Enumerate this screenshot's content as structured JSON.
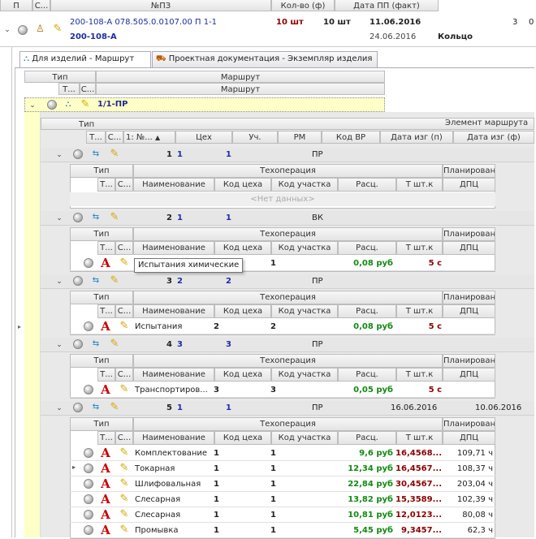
{
  "top": {
    "header": {
      "col1": "П",
      "col2": "С...",
      "col3": "№ПЗ",
      "col4": "Кол-во (ф)",
      "col5": "Дата ПП (факт)"
    },
    "row": {
      "pz": "200-108-А 078.505.0.0107.00 П 1-1",
      "pz2": "200-108-А",
      "qty_red": "10 шт",
      "qty": "10 шт",
      "date_fact": "11.06.2016",
      "date2": "24.06.2016",
      "extra": "Кольцо",
      "count": "3",
      "count2": "0"
    }
  },
  "tabs": [
    {
      "label": "Для изделий - Маршрут",
      "active": true,
      "icon": "route-icon"
    },
    {
      "label": "Проектная документация - Экземпляр изделия",
      "active": false,
      "icon": "truck-icon"
    }
  ],
  "route_header": {
    "tip": "Тип",
    "marshrut": "Маршрут",
    "marshrut2": "Маршрут",
    "t": "Т...",
    "c": "С..."
  },
  "route_row": {
    "label": "1/1-ПР"
  },
  "elem_header": {
    "tip": "Тип",
    "element": "Элемент маршрута",
    "t": "Т...",
    "c": "С...",
    "num": "1: №...",
    "tseh": "Цех",
    "uch": "Уч.",
    "rm": "РМ",
    "kod_vr": "Код ВР",
    "date_p": "Дата изг (п)",
    "date_f": "Дата изг (ф)"
  },
  "op_header": {
    "tip": "Тип",
    "tehop": "Техоперация",
    "plan": "Планирован",
    "t": "Т...",
    "c": "С...",
    "name": "Наименование",
    "kod_tseha": "Код цеха",
    "kod_uch": "Код участка",
    "rasc": "Расц.",
    "tsht": "Т шт.к",
    "dpc": "ДПЦ"
  },
  "groups": [
    {
      "num": "1",
      "tseh": "1",
      "uch": "1",
      "kod_vr": "ПР",
      "date_p": "",
      "date_f": "",
      "ops": [],
      "nodata": "<Нет данных>"
    },
    {
      "num": "2",
      "tseh": "1",
      "uch": "1",
      "kod_vr": "ВК",
      "date_p": "",
      "date_f": "",
      "ops": [
        {
          "name": "Испытания химические",
          "kt": "",
          "ku": "1",
          "rasc": "0,08 руб",
          "tsht": "5 с",
          "dpc": ""
        }
      ]
    },
    {
      "num": "3",
      "tseh": "2",
      "uch": "2",
      "kod_vr": "ПР",
      "date_p": "",
      "date_f": "",
      "ops": [
        {
          "name": "Испытания",
          "kt": "2",
          "ku": "2",
          "rasc": "0,08 руб",
          "tsht": "5 с",
          "dpc": ""
        }
      ]
    },
    {
      "num": "4",
      "tseh": "3",
      "uch": "3",
      "kod_vr": "ПР",
      "date_p": "",
      "date_f": "",
      "ops": [
        {
          "name": "Транспортиров...",
          "kt": "3",
          "ku": "3",
          "rasc": "0,05 руб",
          "tsht": "5 с",
          "dpc": ""
        }
      ]
    },
    {
      "num": "5",
      "tseh": "1",
      "uch": "1",
      "kod_vr": "ПР",
      "date_p": "16.06.2016",
      "date_f": "10.06.2016",
      "ops": [
        {
          "name": "Комплектование",
          "kt": "1",
          "ku": "1",
          "rasc": "9,6 руб",
          "tsht": "16,4568...",
          "dpc": "109,71 ч"
        },
        {
          "name": "Токарная",
          "kt": "1",
          "ku": "1",
          "rasc": "12,34 руб",
          "tsht": "16,4567...",
          "dpc": "108,37 ч"
        },
        {
          "name": "Шлифовальная",
          "kt": "1",
          "ku": "1",
          "rasc": "22,84 руб",
          "tsht": "30,4567...",
          "dpc": "203,04 ч"
        },
        {
          "name": "Слесарная",
          "kt": "1",
          "ku": "1",
          "rasc": "13,82 руб",
          "tsht": "15,3589...",
          "dpc": "102,39 ч"
        },
        {
          "name": "Слесарная",
          "kt": "1",
          "ku": "1",
          "rasc": "10,81 руб",
          "tsht": "12,0123...",
          "dpc": "80,08 ч"
        },
        {
          "name": "Промывка",
          "kt": "1",
          "ku": "1",
          "rasc": "5,45 руб",
          "tsht": "9,3457...",
          "dpc": "62,3 ч"
        }
      ]
    }
  ],
  "tooltip": "Испытания химические"
}
